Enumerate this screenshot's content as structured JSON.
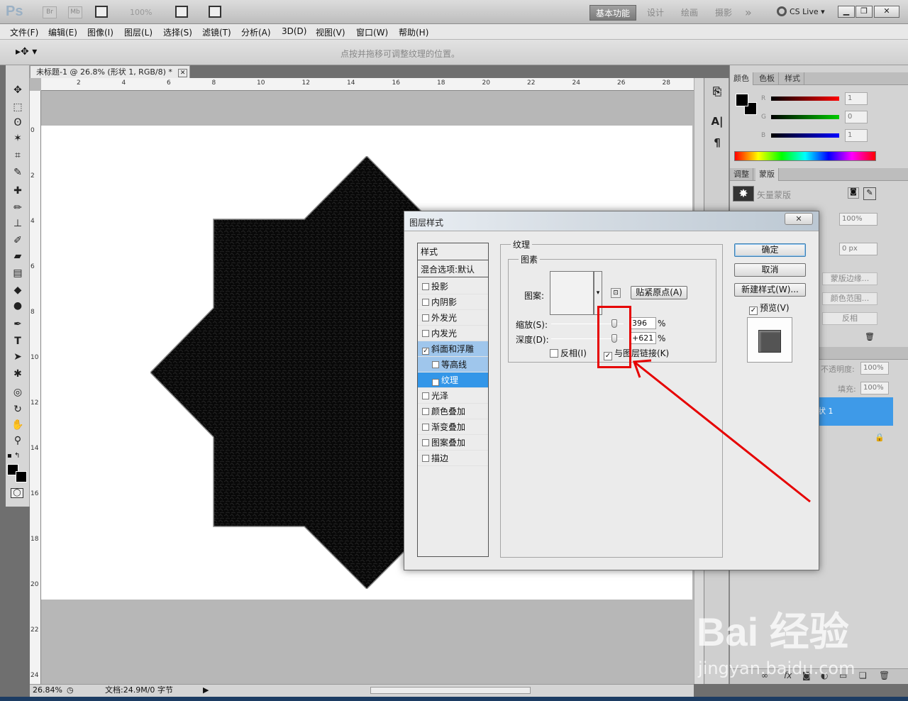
{
  "appbar": {
    "logo": "Ps",
    "bridge": "Br",
    "minibridge": "Mb",
    "zoom": "100%",
    "workspaces": [
      "设计",
      "绘画",
      "摄影"
    ],
    "active_workspace": "基本功能",
    "more": "»",
    "cslive": "CS Live"
  },
  "menu": [
    "文件(F)",
    "编辑(E)",
    "图像(I)",
    "图层(L)",
    "选择(S)",
    "滤镜(T)",
    "分析(A)",
    "3D(D)",
    "视图(V)",
    "窗口(W)",
    "帮助(H)"
  ],
  "options": {
    "hint": "点按并拖移可调整纹理的位置。"
  },
  "document": {
    "tab_title": "未标题-1 @ 26.8% (形状 1, RGB/8) *",
    "h_ticks": [
      "2",
      "4",
      "6",
      "8",
      "10",
      "12",
      "14",
      "16",
      "18",
      "20",
      "22",
      "24",
      "26",
      "28"
    ],
    "v_ticks": [
      "0",
      "2",
      "4",
      "6",
      "8",
      "10",
      "12",
      "14",
      "16",
      "18",
      "20",
      "22",
      "24"
    ]
  },
  "status": {
    "zoom": "26.84%",
    "doc_size": "文档:24.9M/0 字节"
  },
  "color_panel": {
    "tabs": [
      "颜色",
      "色板",
      "样式"
    ],
    "r_label": "R",
    "g_label": "G",
    "b_label": "B",
    "r": "1",
    "g": "0",
    "b": "1"
  },
  "masks_panel": {
    "tabs": [
      "调整",
      "蒙版"
    ],
    "vector_mask": "矢量蒙版",
    "density": "100%",
    "feather": "0 px",
    "mask_edge": "蒙版边缘...",
    "color_range": "颜色范围...",
    "invert": "反相"
  },
  "layers_panel": {
    "opacity_label": "不透明度:",
    "opacity": "100%",
    "fill_label": "填充:",
    "fill": "100%",
    "layer_name": "状 1"
  },
  "dialog": {
    "title": "图层样式",
    "close": "✕",
    "styles_header": "样式",
    "blend_options": "混合选项:默认",
    "styles": [
      {
        "label": "投影",
        "checked": false
      },
      {
        "label": "内阴影",
        "checked": false
      },
      {
        "label": "外发光",
        "checked": false
      },
      {
        "label": "内发光",
        "checked": false
      },
      {
        "label": "斜面和浮雕",
        "checked": true
      },
      {
        "label": "等高线",
        "checked": false
      },
      {
        "label": "纹理",
        "checked": true
      },
      {
        "label": "光泽",
        "checked": false
      },
      {
        "label": "颜色叠加",
        "checked": false
      },
      {
        "label": "渐变叠加",
        "checked": false
      },
      {
        "label": "图案叠加",
        "checked": false
      },
      {
        "label": "描边",
        "checked": false
      }
    ],
    "texture_group": "纹理",
    "elements_group": "图素",
    "pattern_label": "图案:",
    "snap_origin": "贴紧原点(A)",
    "scale_label": "缩放(S):",
    "scale_value": "396",
    "depth_label": "深度(D):",
    "depth_value": "+621",
    "percent": "%",
    "invert_label": "反相(I)",
    "invert_checked": false,
    "link_label": "与图层链接(K)",
    "link_checked": true,
    "ok": "确定",
    "cancel": "取消",
    "new_style": "新建样式(W)...",
    "preview_label": "预览(V)",
    "preview_checked": true
  },
  "watermark": {
    "logo": "Bai 经验",
    "url": "jingyan.baidu.com"
  },
  "colors": {
    "accent": "#3396e8",
    "annotation": "#e60000"
  }
}
